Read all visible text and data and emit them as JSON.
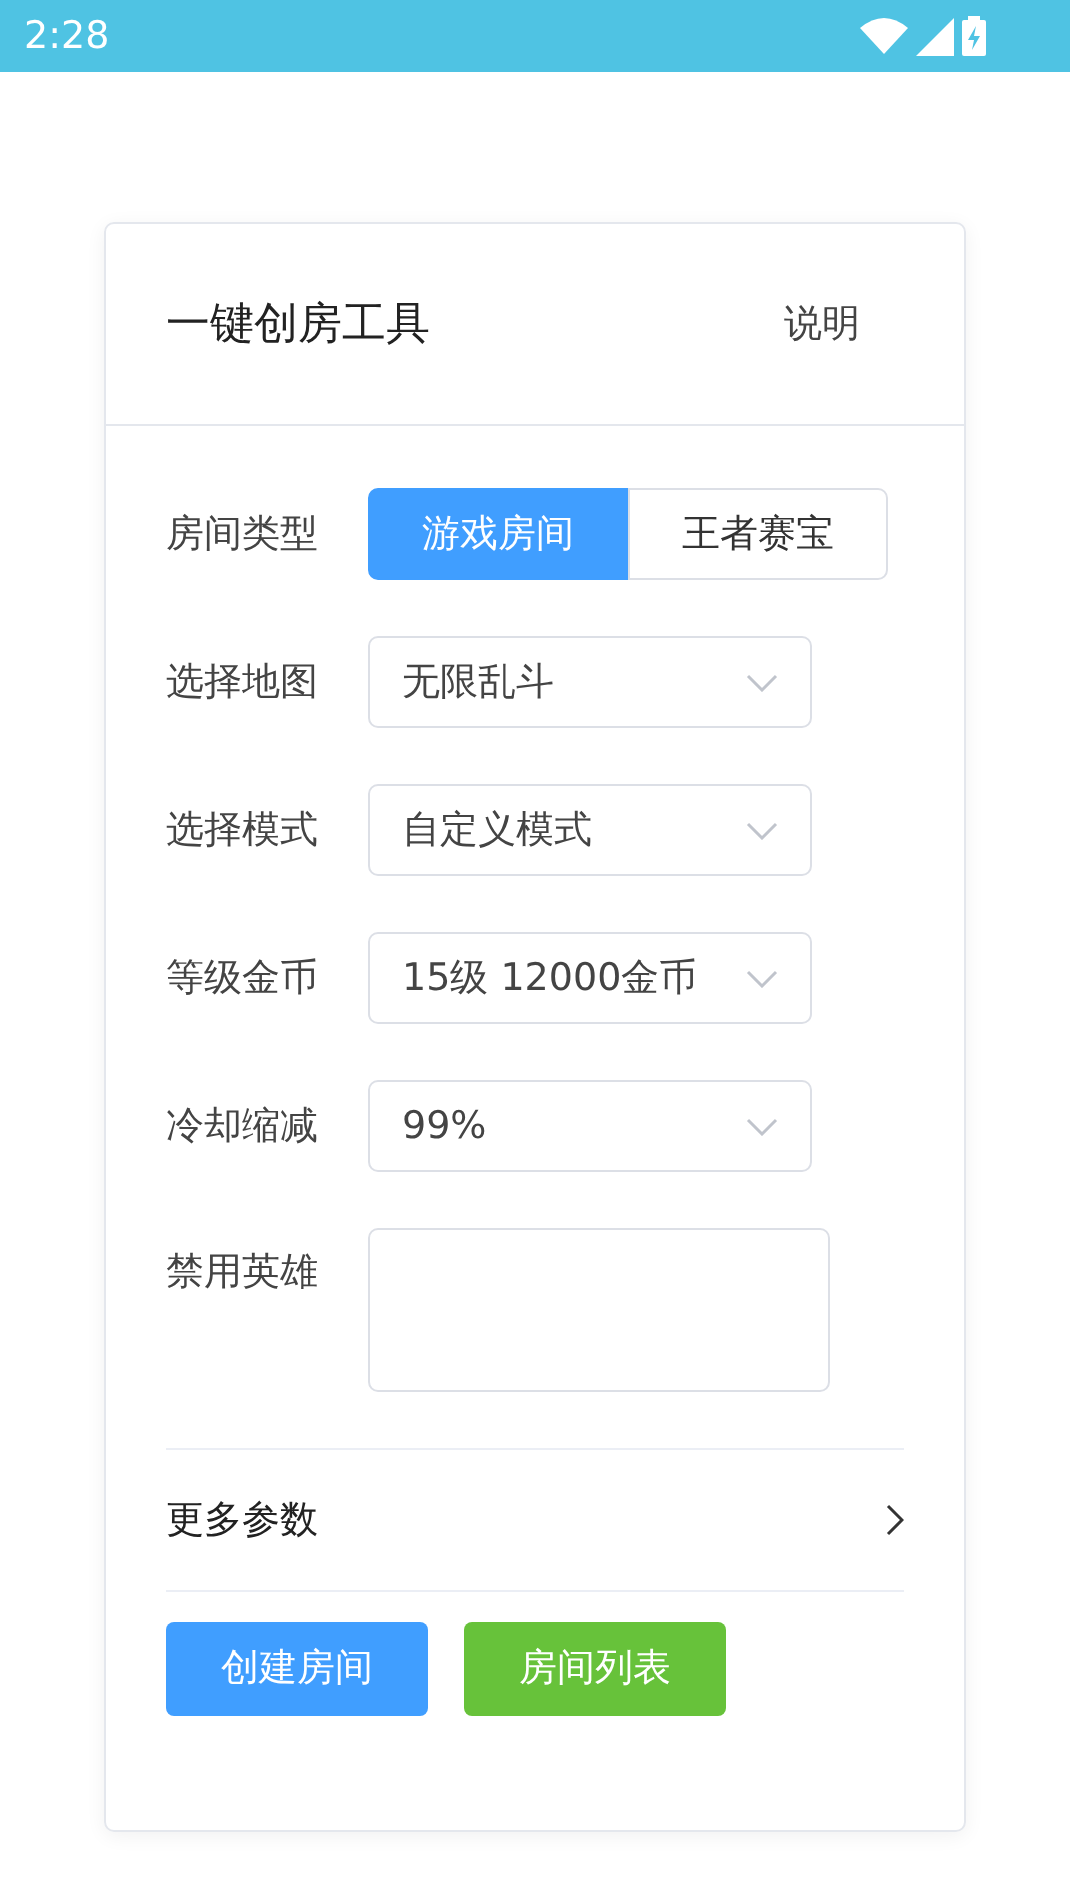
{
  "status_bar": {
    "time": "2:28"
  },
  "card": {
    "title": "一键创房工具",
    "help_link": "说明"
  },
  "fields": [
    {
      "kind": "segmented",
      "label": "房间类型",
      "options": [
        {
          "label": "游戏房间",
          "selected": true
        },
        {
          "label": "王者赛宝",
          "selected": false
        }
      ]
    },
    {
      "kind": "select",
      "label": "选择地图",
      "value": "无限乱斗"
    },
    {
      "kind": "select",
      "label": "选择模式",
      "value": "自定义模式"
    },
    {
      "kind": "select",
      "label": "等级金币",
      "value": "15级 12000金币"
    },
    {
      "kind": "select",
      "label": "冷却缩减",
      "value": "99%"
    },
    {
      "kind": "textarea",
      "label": "禁用英雄"
    }
  ],
  "more_row": {
    "label": "更多参数"
  },
  "buttons": [
    {
      "label": "创建房间",
      "color": "#409eff"
    },
    {
      "label": "房间列表",
      "color": "#67c23a"
    }
  ]
}
